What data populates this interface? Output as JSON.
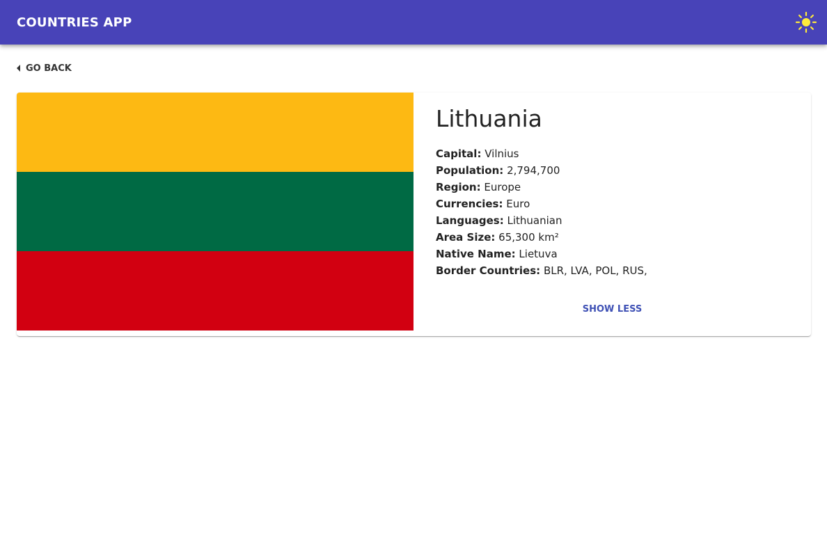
{
  "header": {
    "app_title": "COUNTRIES APP",
    "theme_icon": "sun-icon",
    "theme_icon_color": "#ffeb3b",
    "bar_color": "#4843b8"
  },
  "navigation": {
    "back_label": "GO BACK",
    "back_icon": "caret-left-icon"
  },
  "country": {
    "name": "Lithuania",
    "flag_colors": [
      "#fdb913",
      "#006a44",
      "#d20011"
    ],
    "fields": [
      {
        "label": "Capital:",
        "value": "Vilnius"
      },
      {
        "label": "Population:",
        "value": "2,794,700"
      },
      {
        "label": "Region:",
        "value": "Europe"
      },
      {
        "label": "Currencies:",
        "value": "Euro"
      },
      {
        "label": "Languages:",
        "value": "Lithuanian"
      },
      {
        "label": "Area Size:",
        "value": "65,300 km²"
      },
      {
        "label": "Native Name:",
        "value": "Lietuva"
      },
      {
        "label": "Border Countries:",
        "value": "BLR, LVA, POL, RUS,"
      }
    ],
    "toggle_label": "SHOW LESS",
    "accent_color": "#3f51b5"
  }
}
